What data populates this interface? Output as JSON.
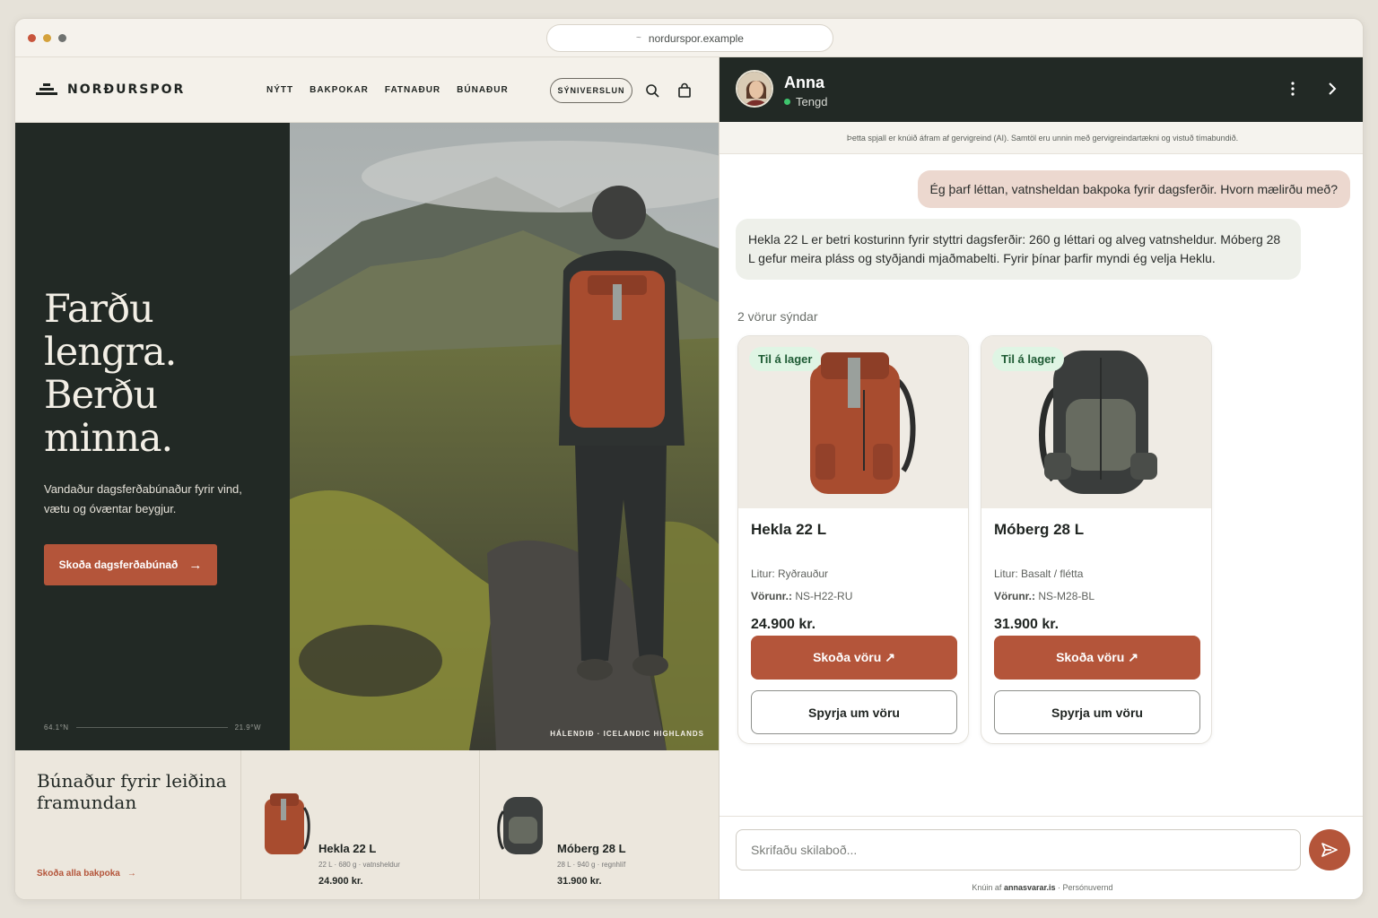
{
  "browser": {
    "url": "nordurspor.example"
  },
  "store": {
    "brand": "NORÐURSPOR",
    "nav": [
      "NÝTT",
      "BAKPOKAR",
      "FATNAÐUR",
      "BÚNAÐUR"
    ],
    "showroom_label": "SÝNIVERSLUN",
    "hero": {
      "title": "Farðu lengra. Berðu minna.",
      "subtitle": "Vandaður dagsferðabúnaður fyrir vind, vætu og óvæntar beygjur.",
      "cta": "Skoða dagsferðabúnað",
      "lat": "64.1°N",
      "lon": "21.9°W",
      "caption": "HÁLENDIÐ · ICELANDIC HIGHLANDS"
    },
    "strip": {
      "title": "Búnaður fyrir leiðina framundan",
      "link": "Skoða alla bakpoka",
      "items": [
        {
          "name": "Hekla 22 L",
          "spec": "22 L · 680 g · vatnsheldur",
          "price": "24.900 kr."
        },
        {
          "name": "Móberg 28 L",
          "spec": "28 L · 940 g · regnhlíf",
          "price": "31.900 kr."
        }
      ]
    }
  },
  "chat": {
    "agent_name": "Anna",
    "agent_status": "Tengd",
    "disclaimer": "Þetta spjall er knúið áfram af gervigreind (AI). Samtöl eru unnin með gervigreindartækni og vistuð tímabundið.",
    "user_message": "Ég þarf léttan, vatnsheldan bakpoka fyrir dagsferðir. Hvorn mælirðu með?",
    "bot_message": "Hekla 22 L er betri kosturinn fyrir styttri dagsferðir: 260 g léttari og alveg vatnsheldur. Móberg 28 L gefur meira pláss og styðjandi mjaðmabelti. Fyrir þínar þarfir myndi ég velja Heklu.",
    "shown_count": "2 vörur sýndar",
    "products": [
      {
        "badge": "Til á lager",
        "name": "Hekla 22 L",
        "color": "Litur: Ryðrauður",
        "sku_label": "Vörunr.:",
        "sku": "NS-H22-RU",
        "price": "24.900 kr.",
        "view_label": "Skoða vöru ↗",
        "ask_label": "Spyrja um vöru"
      },
      {
        "badge": "Til á lager",
        "name": "Móberg 28 L",
        "color": "Litur: Basalt / flétta",
        "sku_label": "Vörunr.:",
        "sku": "NS-M28-BL",
        "price": "31.900 kr.",
        "view_label": "Skoða vöru ↗",
        "ask_label": "Spyrja um vöru"
      }
    ],
    "input_placeholder": "Skrifaðu skilaboð...",
    "footer_prefix": "Knúin af",
    "footer_brand": "annasvarar.is",
    "footer_sep": "·",
    "footer_privacy": "Persónuvernd"
  },
  "colors": {
    "accent": "#b4553a",
    "dark": "#222925",
    "cream": "#f4f1ea",
    "online": "#3ec46d"
  }
}
